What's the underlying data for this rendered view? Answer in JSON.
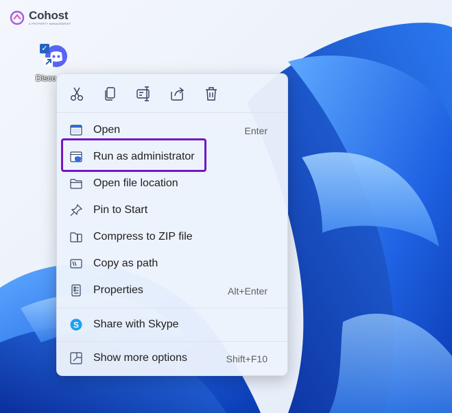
{
  "watermark": {
    "name": "Cohost",
    "tagline": "A PROPERTY MANAGEMENT"
  },
  "desktop": {
    "icon_label": "Disco"
  },
  "toolbar": {
    "buttons": [
      {
        "name": "cut",
        "icon": "scissors-icon"
      },
      {
        "name": "copy",
        "icon": "copy-icon"
      },
      {
        "name": "rename",
        "icon": "rename-icon"
      },
      {
        "name": "share",
        "icon": "share-icon"
      },
      {
        "name": "delete",
        "icon": "trash-icon"
      }
    ]
  },
  "menu": {
    "items": [
      {
        "label": "Open",
        "shortcut": "Enter",
        "icon": "open-icon"
      },
      {
        "label": "Run as administrator",
        "shortcut": "",
        "icon": "shield-app-icon"
      },
      {
        "label": "Open file location",
        "shortcut": "",
        "icon": "folder-icon"
      },
      {
        "label": "Pin to Start",
        "shortcut": "",
        "icon": "pin-icon"
      },
      {
        "label": "Compress to ZIP file",
        "shortcut": "",
        "icon": "zip-folder-icon"
      },
      {
        "label": "Copy as path",
        "shortcut": "",
        "icon": "path-icon"
      },
      {
        "label": "Properties",
        "shortcut": "Alt+Enter",
        "icon": "properties-icon"
      },
      {
        "label": "Share with Skype",
        "shortcut": "",
        "icon": "skype-icon"
      },
      {
        "label": "Show more options",
        "shortcut": "Shift+F10",
        "icon": "more-options-icon"
      }
    ]
  },
  "colors": {
    "highlight": "#7515c4",
    "wallpaper_blue": "#1e63e0",
    "menu_bg": "#ecf2fc"
  }
}
